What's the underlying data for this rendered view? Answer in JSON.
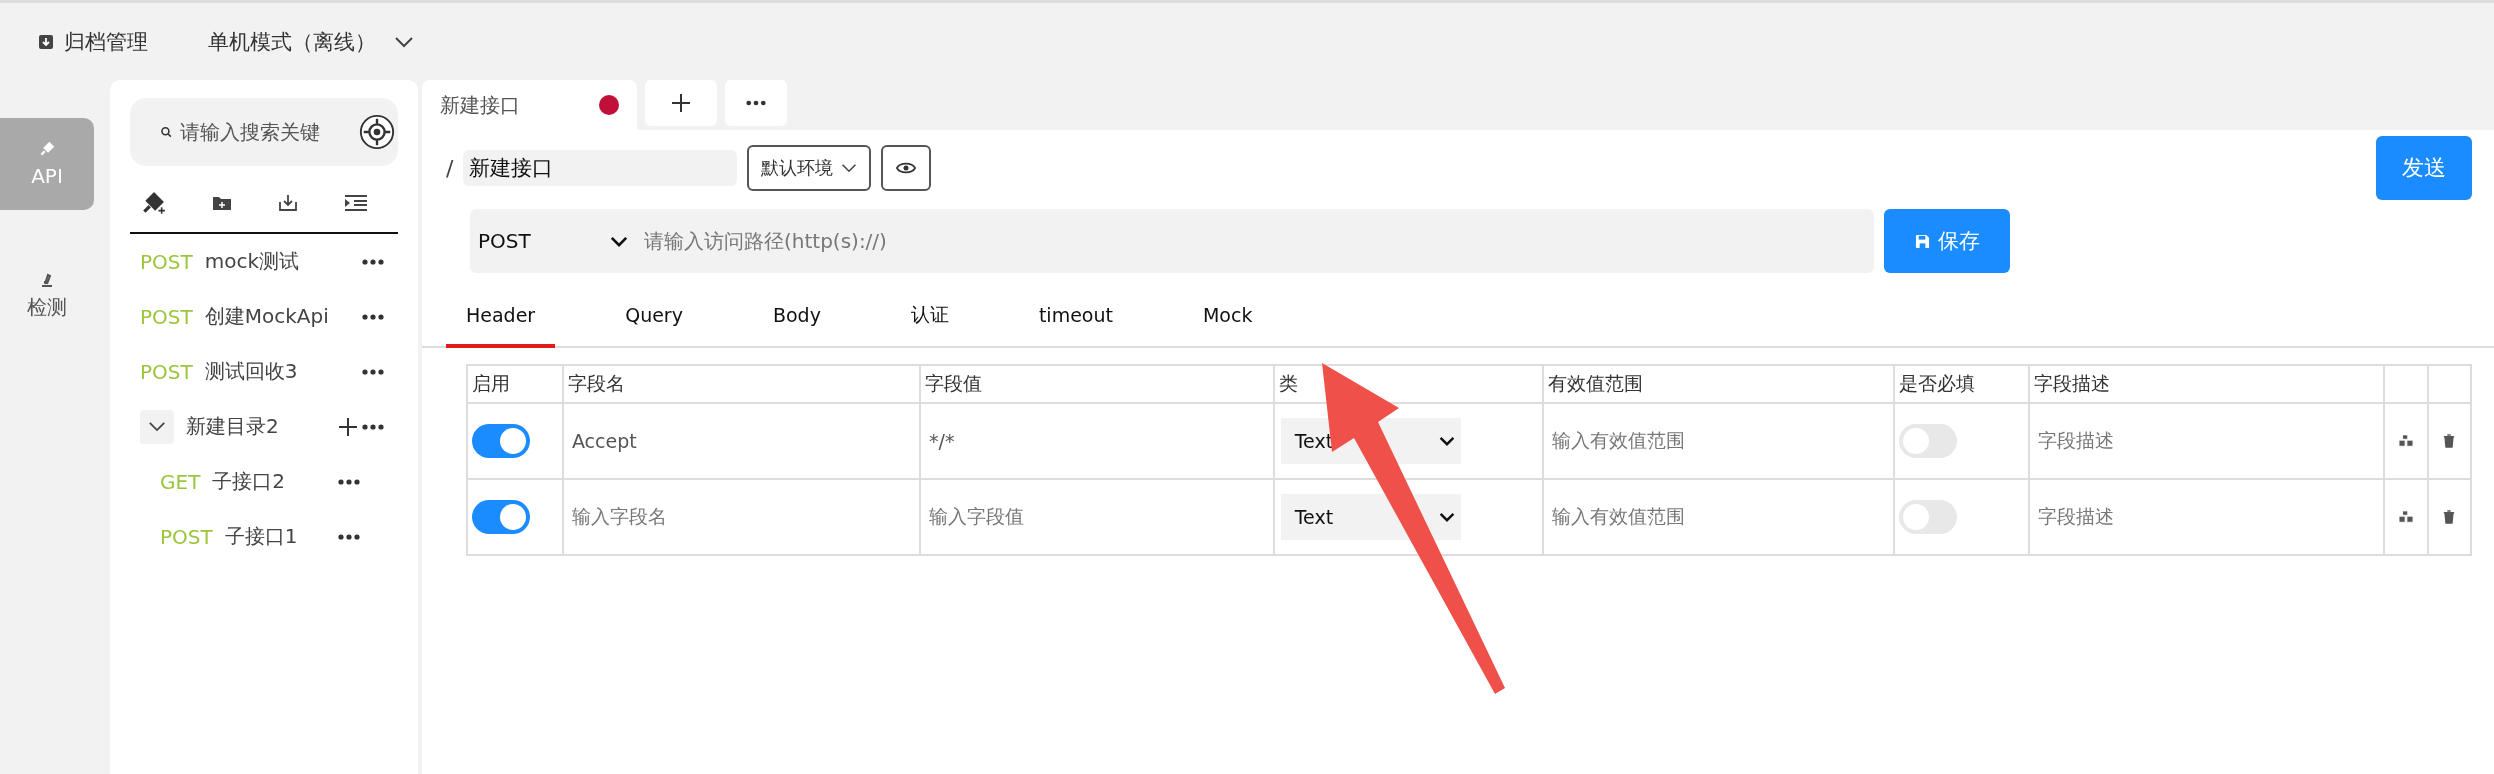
{
  "header": {
    "archive": "归档管理",
    "mode": "单机模式（离线）"
  },
  "rail": [
    {
      "label": "API",
      "kind": "api",
      "selected": true
    },
    {
      "label": "检测",
      "kind": "test",
      "selected": false
    }
  ],
  "sidebar": {
    "search_placeholder": "请输入搜索关键",
    "items": [
      {
        "kind": "api",
        "method": "POST",
        "name": "mock测试"
      },
      {
        "kind": "api",
        "method": "POST",
        "name": "创建MockApi"
      },
      {
        "kind": "api",
        "method": "POST",
        "name": "测试回收3"
      },
      {
        "kind": "folder",
        "name": "新建目录2",
        "expanded": true,
        "children": [
          {
            "kind": "api",
            "method": "GET",
            "name": "子接口2"
          },
          {
            "kind": "api",
            "method": "POST",
            "name": "子接口1"
          }
        ]
      }
    ]
  },
  "tabs": [
    {
      "label": "新建接口",
      "unsaved": true,
      "selected": true
    }
  ],
  "request": {
    "separator": "/",
    "name": "新建接口",
    "environment": "默认环境",
    "method": "POST",
    "url_placeholder": "请输入访问路径(http(s)://)",
    "save": "保存",
    "send": "发送"
  },
  "param_tabs": [
    {
      "label": "Header",
      "selected": true
    },
    {
      "label": "Query",
      "selected": false
    },
    {
      "label": "Body",
      "selected": false
    },
    {
      "label": "认证",
      "selected": false
    },
    {
      "label": "timeout",
      "selected": false
    },
    {
      "label": "Mock",
      "selected": false
    }
  ],
  "table": {
    "columns": [
      "启用",
      "字段名",
      "字段值",
      "类",
      "有效值范围",
      "是否必填",
      "字段描述"
    ],
    "rows": [
      {
        "enabled": true,
        "name": {
          "value": "Accept"
        },
        "value": {
          "value": "*/*"
        },
        "type": "Text",
        "range": {
          "placeholder": "输入有效值范围"
        },
        "required": false,
        "description": {
          "placeholder": "字段描述"
        }
      },
      {
        "enabled": true,
        "name": {
          "placeholder": "输入字段名"
        },
        "value": {
          "placeholder": "输入字段值"
        },
        "type": "Text",
        "range": {
          "placeholder": "输入有效值范围"
        },
        "required": false,
        "description": {
          "placeholder": "字段描述"
        }
      }
    ]
  }
}
